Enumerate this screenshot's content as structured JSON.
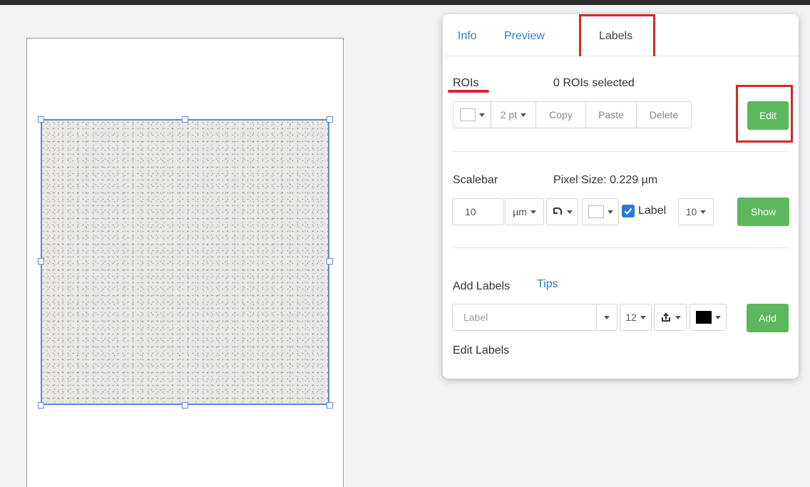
{
  "tabs": [
    {
      "label": "Info"
    },
    {
      "label": "Preview"
    },
    {
      "label": "Labels"
    }
  ],
  "rois": {
    "title": "ROIs",
    "selected_text": "0 ROIs selected",
    "line_width": "2 pt",
    "copy_label": "Copy",
    "paste_label": "Paste",
    "delete_label": "Delete",
    "edit_label": "Edit"
  },
  "scalebar": {
    "title": "Scalebar",
    "pixel_size_text": "Pixel Size: 0.229 µm",
    "length_value": "10",
    "unit": "µm",
    "label_checkbox": "Label",
    "label_checked": true,
    "font_size": "10",
    "show_label": "Show"
  },
  "add_labels": {
    "title": "Add Labels",
    "tips_link": "Tips",
    "label_placeholder": "Label",
    "font_size": "12",
    "color": "#000000",
    "add_label": "Add"
  },
  "edit_labels": {
    "title": "Edit Labels"
  },
  "colors": {
    "accent_green": "#5cb85c",
    "link_blue": "#2f7ec4",
    "highlight_red": "#d32a2a",
    "selection_blue": "#5b8bd9"
  }
}
